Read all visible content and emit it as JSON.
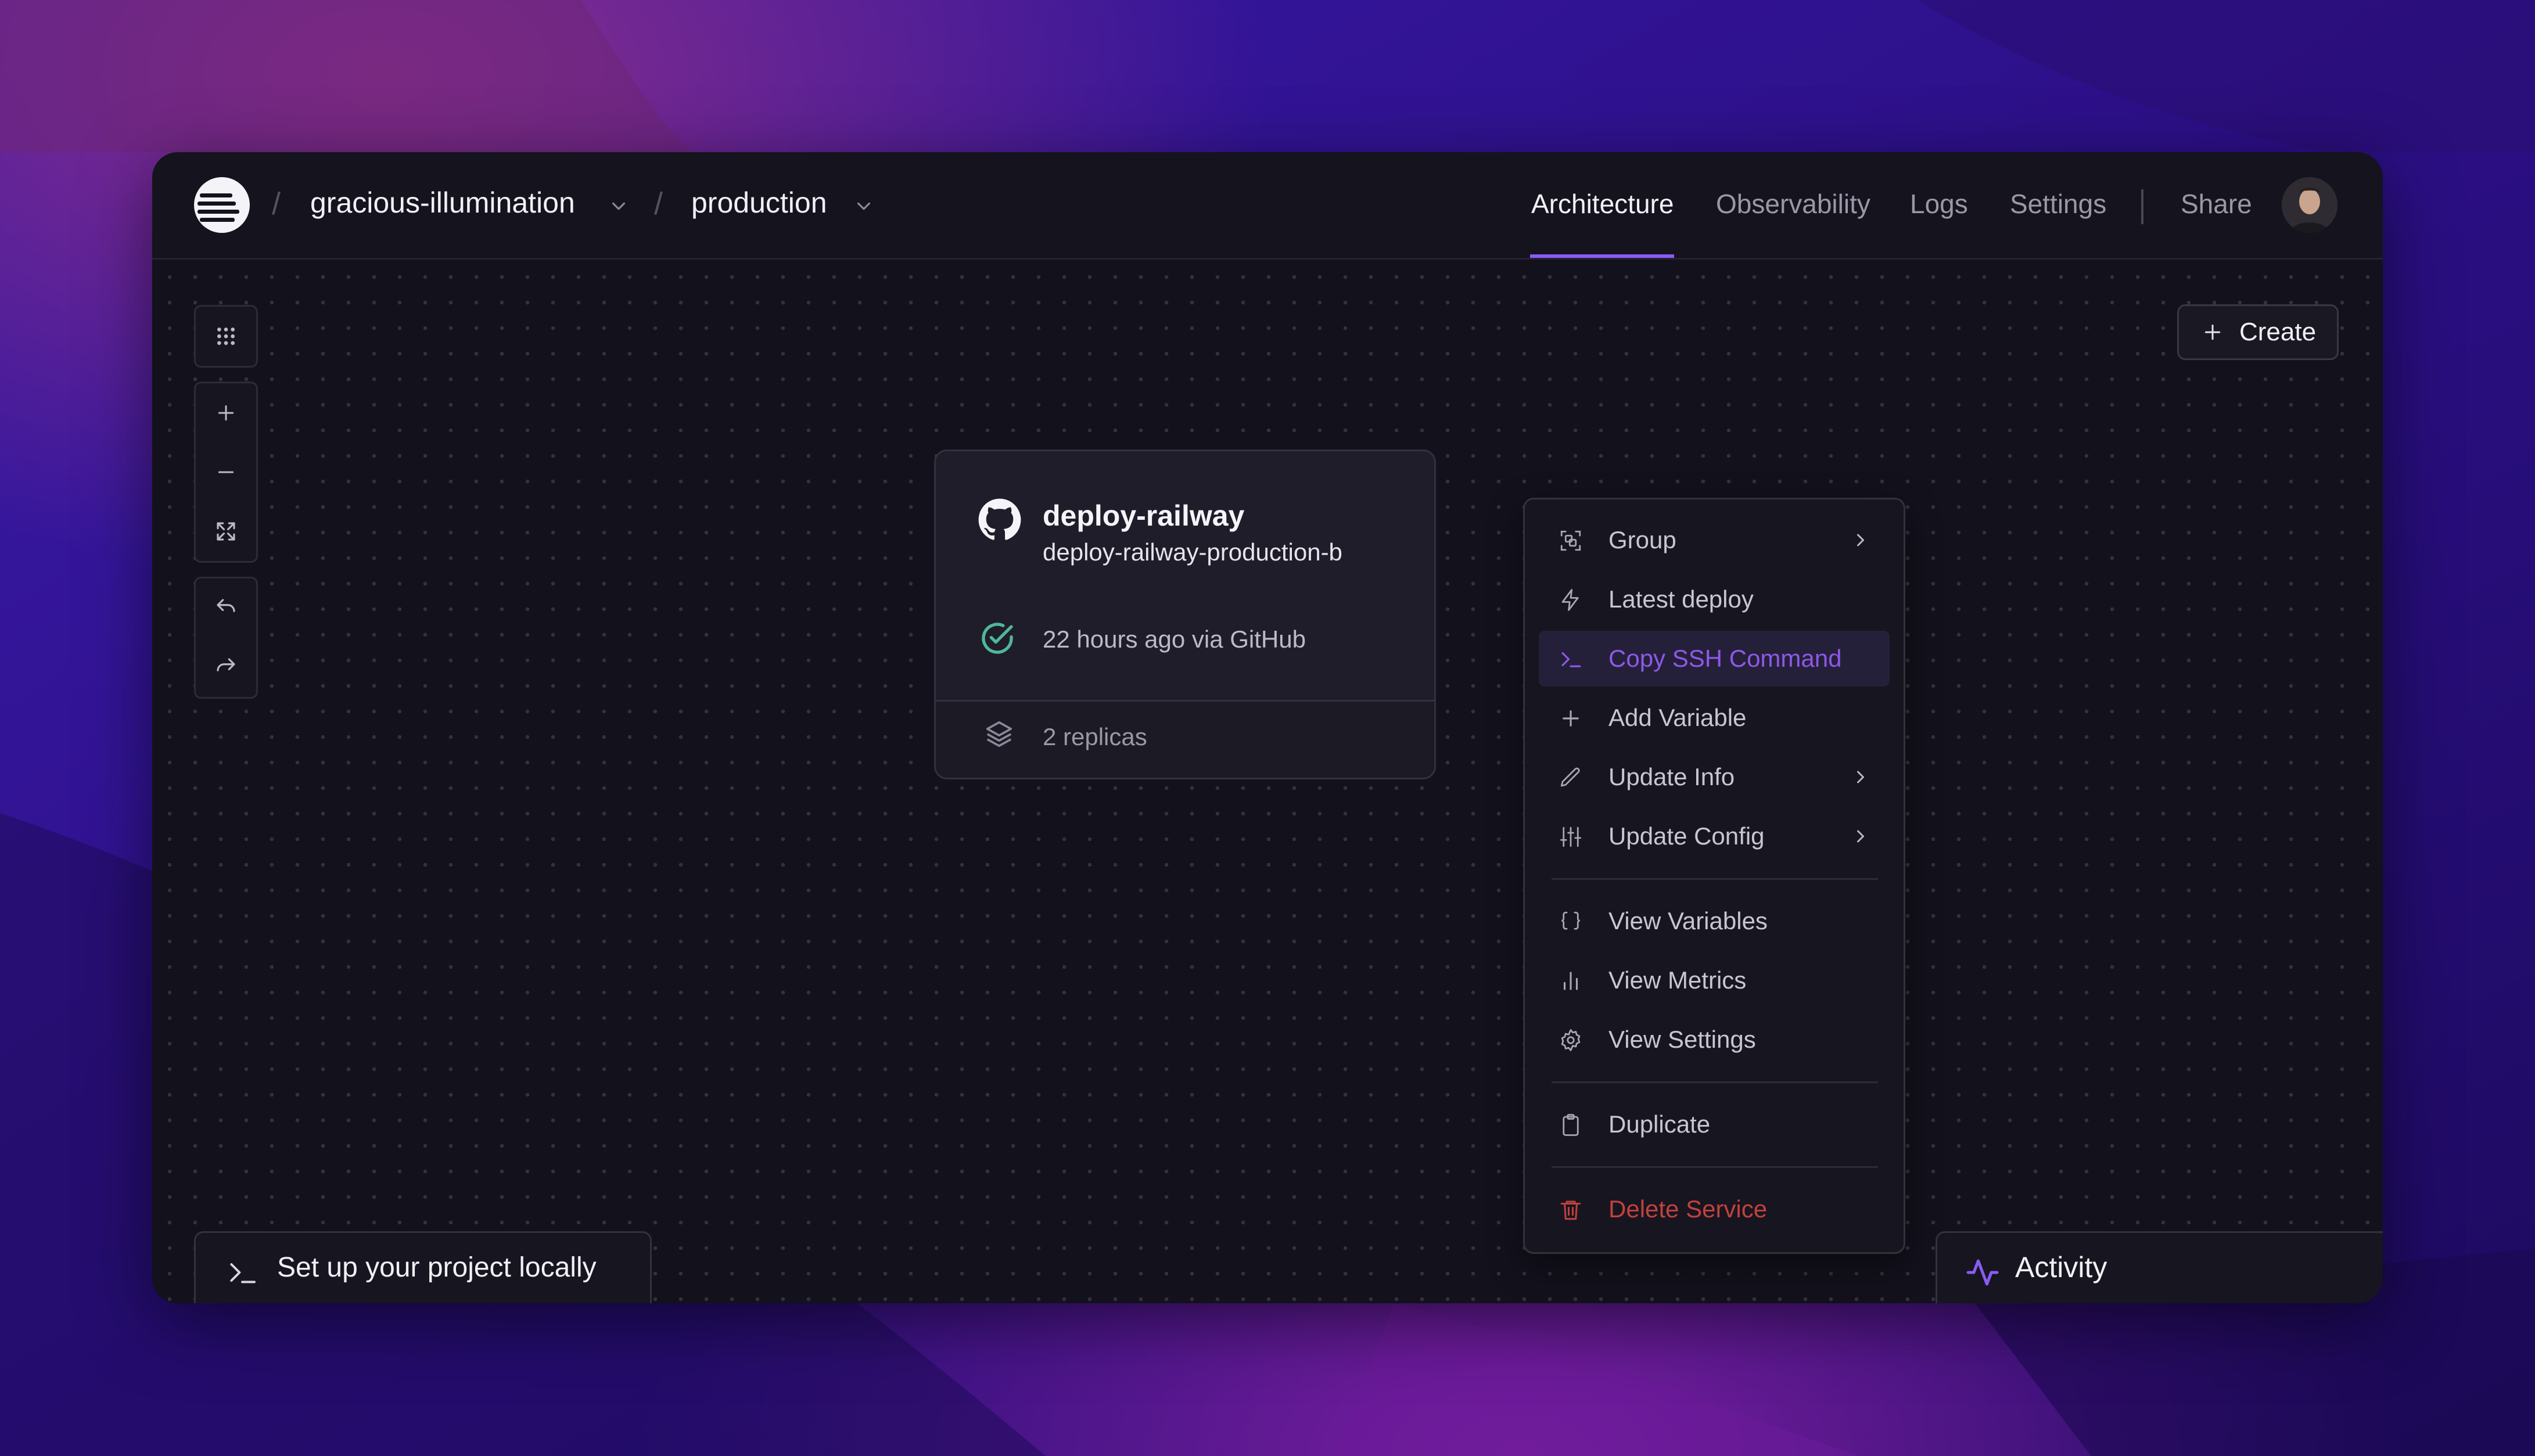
{
  "header": {
    "project_name": "gracious-illumination",
    "environment": "production",
    "nav": [
      "Architecture",
      "Observability",
      "Logs",
      "Settings"
    ],
    "share_label": "Share"
  },
  "toolbar": {
    "create_label": "Create"
  },
  "service_card": {
    "name": "deploy-railway",
    "subdomain": "deploy-railway-production-b",
    "deploy_status": "22 hours ago via GitHub",
    "replicas": "2 replicas"
  },
  "context_menu": {
    "items": [
      {
        "label": "Group",
        "icon": "group-select-icon"
      },
      {
        "label": "Latest deploy",
        "icon": "lightning-icon"
      },
      {
        "label": "Copy SSH Command",
        "icon": "terminal-icon"
      },
      {
        "label": "Add Variable",
        "icon": "plus-icon"
      },
      {
        "label": "Update Info",
        "icon": "pencil-icon"
      },
      {
        "label": "Update Config",
        "icon": "sliders-icon"
      },
      {
        "label": "View Variables",
        "icon": "braces-icon"
      },
      {
        "label": "View Metrics",
        "icon": "bar-chart-icon"
      },
      {
        "label": "View Settings",
        "icon": "gear-icon"
      },
      {
        "label": "Duplicate",
        "icon": "clipboard-icon"
      },
      {
        "label": "Delete Service",
        "icon": "trash-icon"
      }
    ]
  },
  "bottom": {
    "setup_label": "Set up your project locally",
    "activity_label": "Activity"
  },
  "colors": {
    "accent": "#8a5cf6",
    "highlight_text": "#8e58e8",
    "danger": "#c2413e",
    "success": "#4fb89a"
  }
}
